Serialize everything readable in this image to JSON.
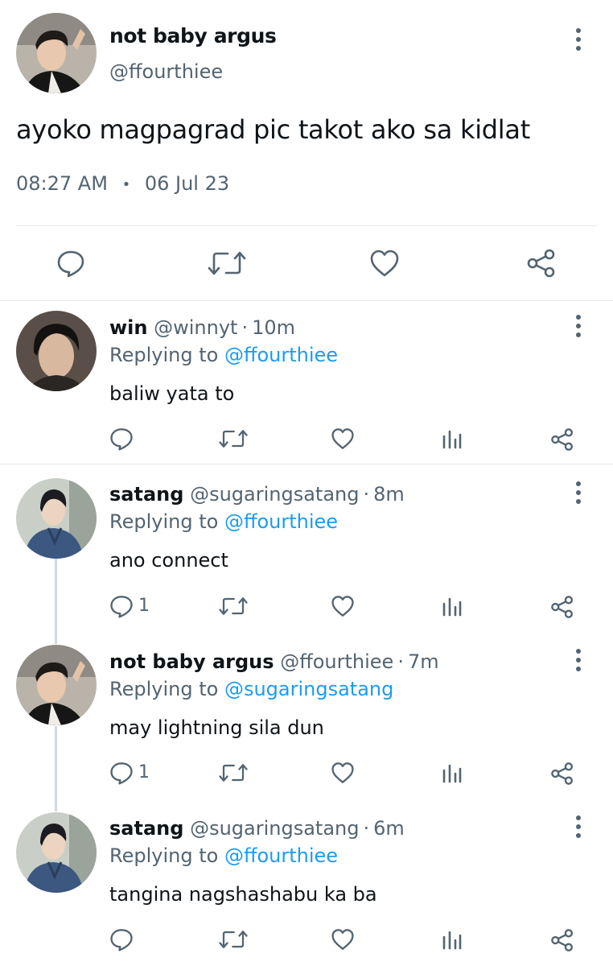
{
  "main_tweet": {
    "display_name": "not baby argus",
    "handle": "@ffourthiee",
    "text": "ayoko magpagrad pic takot ako sa kidlat",
    "time": "08:27 AM",
    "separator": "•",
    "date": "06 Jul 23",
    "actions": [
      "reply-icon",
      "retweet-icon",
      "like-icon",
      "share-icon"
    ]
  },
  "replies": [
    {
      "display_name": "win",
      "handle": "@winnyt",
      "dot": "·",
      "time": "10m",
      "replying_prefix": "Replying to",
      "replying_to": "@ffourthiee",
      "text": "baliw yata to",
      "reply_count": ""
    },
    {
      "display_name": "satang",
      "handle": "@sugaringsatang",
      "dot": "·",
      "time": "8m",
      "replying_prefix": "Replying to",
      "replying_to": "@ffourthiee",
      "text": "ano connect",
      "reply_count": "1"
    },
    {
      "display_name": "not baby argus",
      "handle": "@ffourthiee",
      "dot": "·",
      "time": "7m",
      "replying_prefix": "Replying to",
      "replying_to": "@sugaringsatang",
      "text": "may lightning sila dun",
      "reply_count": "1"
    },
    {
      "display_name": "satang",
      "handle": "@sugaringsatang",
      "dot": "·",
      "time": "6m",
      "replying_prefix": "Replying to",
      "replying_to": "@ffourthiee",
      "text": "tangina nagshashabu ka ba",
      "reply_count": ""
    }
  ],
  "colors": {
    "text": "#0f1419",
    "secondary": "#536471",
    "link": "#1d9bf0",
    "divider": "#e6e9eb"
  }
}
